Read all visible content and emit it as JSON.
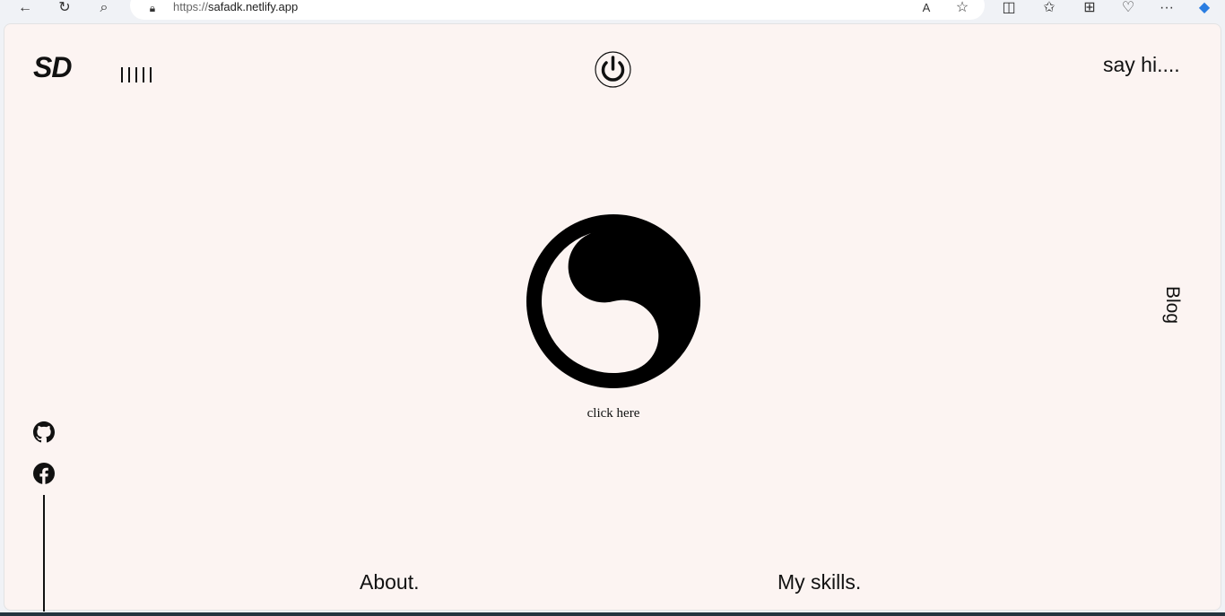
{
  "browser": {
    "url_scheme": "https://",
    "url_host": "safadk.netlify.app"
  },
  "site": {
    "logo": "SD",
    "say_hi": "say hi....",
    "blog": "Blog",
    "click_here": "click here",
    "about": "About.",
    "skills": "My skills."
  }
}
